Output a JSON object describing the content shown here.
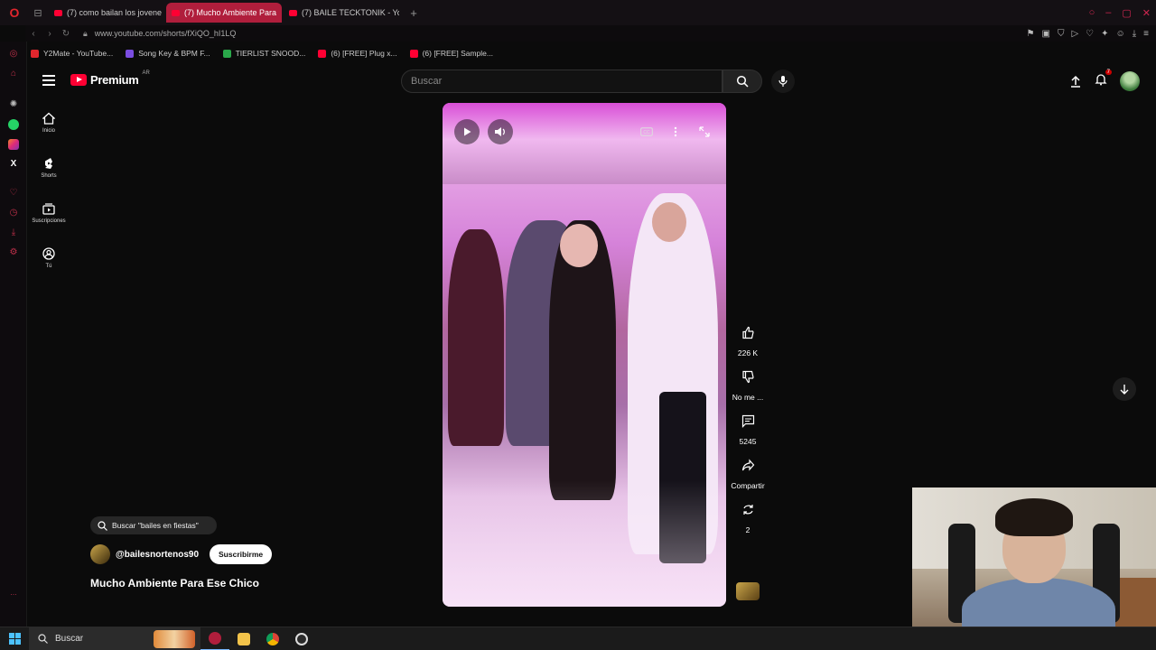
{
  "browser": {
    "tabs": [
      {
        "label": "(7) como bailan los jovene",
        "active": false
      },
      {
        "label": "(7) Mucho Ambiente Para",
        "active": true
      },
      {
        "label": "(7) BAILE TECKTONIK - Yo",
        "active": false
      }
    ],
    "url": "www.youtube.com/shorts/fXiQO_hI1LQ",
    "bookmarks": [
      {
        "label": "Y2Mate - YouTube...",
        "color": "#e0262d"
      },
      {
        "label": "Song Key & BPM F...",
        "color": "#7a4de0"
      },
      {
        "label": "TIERLIST SNOOD...",
        "color": "#2aa84a"
      },
      {
        "label": "(6) [FREE] Plug x...",
        "color": "#ff0033"
      },
      {
        "label": "(6) [FREE] Sample...",
        "color": "#ff0033"
      }
    ],
    "accent": "#b01e3c"
  },
  "youtube": {
    "logo_text": "Premium",
    "logo_region": "AR",
    "search_placeholder": "Buscar",
    "notifications_count": "7",
    "nav": [
      {
        "label": "Inicio",
        "icon": "home-icon"
      },
      {
        "label": "Shorts",
        "icon": "shorts-icon"
      },
      {
        "label": "Suscripciones",
        "icon": "subscriptions-icon"
      },
      {
        "label": "Tú",
        "icon": "you-icon"
      }
    ]
  },
  "short": {
    "like_count": "226 K",
    "dislike_label": "No me ...",
    "comments_count": "5245",
    "share_label": "Compartir",
    "remix_count": "2",
    "search_chip": "Buscar \"bailes en fiestas\"",
    "channel": "@bailesnortenos90",
    "subscribe_label": "Suscribirme",
    "title": "Mucho Ambiente Para Ese Chico"
  },
  "taskbar": {
    "search_label": "Buscar"
  }
}
